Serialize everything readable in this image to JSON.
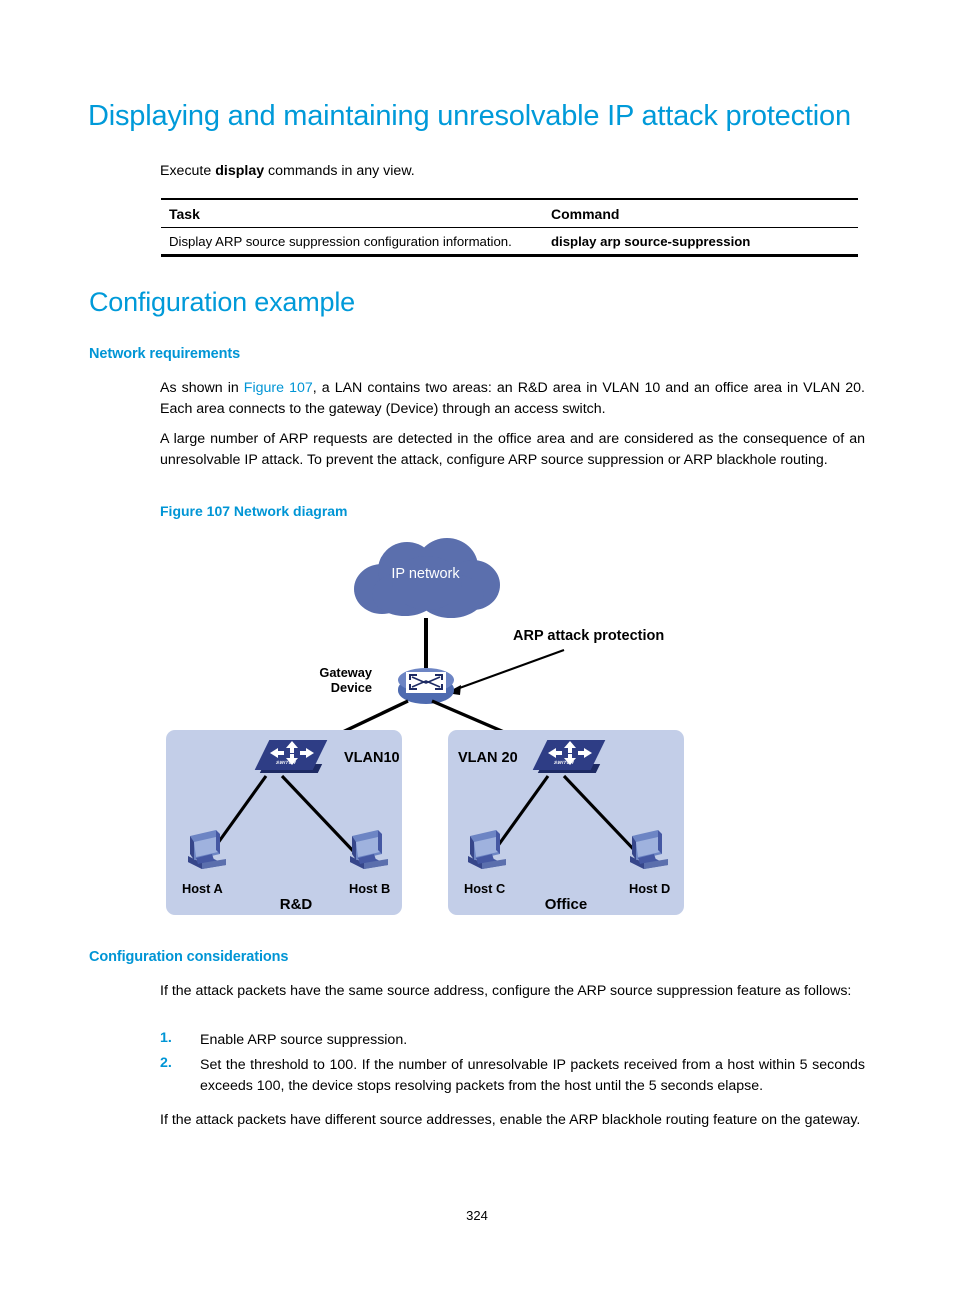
{
  "heading": {
    "title": "Displaying and maintaining unresolvable IP attack protection",
    "config_example": "Configuration example",
    "network_requirements": "Network requirements",
    "configuration_considerations": "Configuration considerations"
  },
  "intro": {
    "before_bold": "Execute ",
    "bold": "display",
    "after_bold": " commands in any view."
  },
  "table": {
    "headers": [
      "Task",
      "Command"
    ],
    "rows": [
      {
        "task": "Display ARP source suppression configuration information.",
        "command": "display arp source-suppression"
      }
    ]
  },
  "network_requirements": {
    "para1_a": "As shown in ",
    "para1_xref": "Figure 107",
    "para1_b": ", a LAN contains two areas: an R&D area in VLAN 10 and an office area in VLAN 20. Each area connects to the gateway (Device) through an access switch.",
    "para2": "A large number of ARP requests are detected in the office area and are considered as the consequence of an unresolvable IP attack. To prevent the attack, configure ARP source suppression or ARP blackhole routing."
  },
  "figure": {
    "caption": "Figure 107 Network diagram",
    "cloud_label": "IP network",
    "gateway_line1": "Gateway",
    "gateway_line2": "Device",
    "annotation": "ARP attack protection",
    "vlan_left": "VLAN10",
    "vlan_right": "VLAN 20",
    "region_left": "R&D",
    "region_right": "Office",
    "hosts": [
      "Host A",
      "Host B",
      "Host C",
      "Host D"
    ],
    "switch_text": "SWITCH"
  },
  "configuration_considerations": {
    "intro": "If the attack packets have the same source address, configure the ARP source suppression feature as follows:",
    "steps": [
      {
        "num": "1.",
        "text": "Enable ARP source suppression."
      },
      {
        "num": "2.",
        "text": "Set the threshold to 100. If the number of unresolvable IP packets received from a host within 5 seconds exceeds 100, the device stops resolving packets from the host until the 5 seconds elapse."
      }
    ],
    "closing": "If the attack packets have different source addresses, enable the ARP blackhole routing feature on the gateway."
  },
  "footer": {
    "page_number": "324"
  },
  "colors": {
    "heading_blue": "#009ad9",
    "subheading_blue": "#0095d5",
    "cloud_blue": "#5b6fad",
    "region_blue": "#c3cee8",
    "switch_navy": "#2e3d85"
  }
}
